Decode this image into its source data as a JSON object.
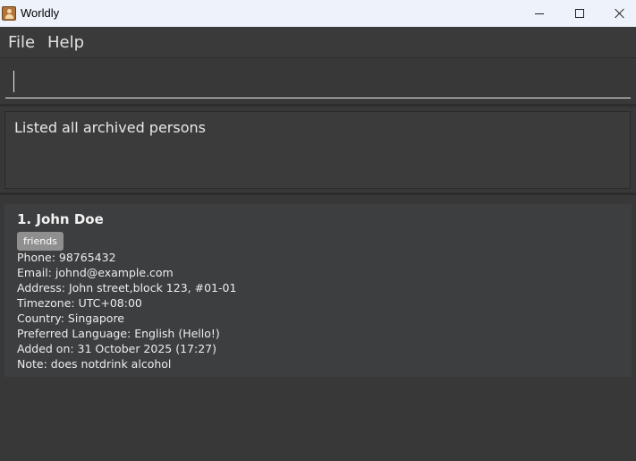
{
  "window": {
    "title": "Worldly",
    "icon": "person-icon",
    "controls": [
      "minimize-icon",
      "maximize-icon",
      "close-icon"
    ]
  },
  "menu": {
    "file_label": "File",
    "help_label": "Help"
  },
  "command": {
    "value": "",
    "placeholder": ""
  },
  "result": {
    "message": "Listed all archived persons"
  },
  "persons": [
    {
      "index_name": "1. John Doe",
      "tags": [
        "friends"
      ],
      "phone": "Phone: 98765432",
      "email": "Email: johnd@example.com",
      "address": "Address: John street,block 123, #01-01",
      "timezone": "Timezone: UTC+08:00",
      "country": "Country: Singapore",
      "language": "Preferred Language: English (Hello!)",
      "added_on": "Added on: 31 October 2025 (17:27)",
      "note": "Note: does notdrink alcohol"
    }
  ]
}
